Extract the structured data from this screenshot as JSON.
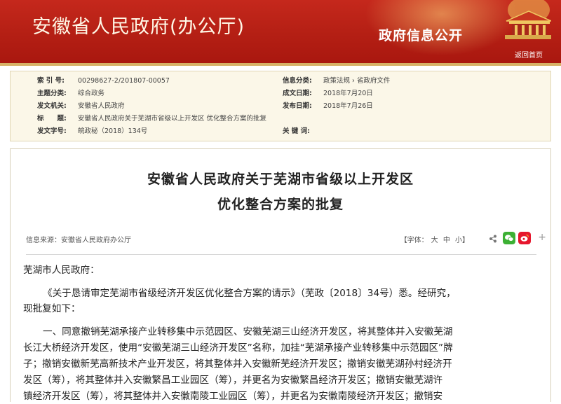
{
  "banner": {
    "site_title": "安徽省人民政府(办公厅)",
    "section_title": "政府信息公开",
    "back_home": "返回首页"
  },
  "meta": {
    "left": [
      {
        "label": "索 引 号:",
        "value": "00298627-2/201807-00057"
      },
      {
        "label": "主题分类:",
        "value": "综合政务"
      },
      {
        "label": "发文机关:",
        "value": "安徽省人民政府"
      },
      {
        "label": "标　　题:",
        "value": "安徽省人民政府关于芜湖市省级以上开发区 优化整合方案的批复"
      },
      {
        "label": "发文字号:",
        "value": "皖政秘（2018）134号"
      }
    ],
    "right": [
      {
        "label": "信息分类:",
        "value": "政策法规 › 省政府文件"
      },
      {
        "label": "成文日期:",
        "value": "2018年7月20日"
      },
      {
        "label": "发布日期:",
        "value": "2018年7月26日"
      },
      {
        "label": "关 键 词:",
        "value": ""
      }
    ]
  },
  "article": {
    "title_line1": "安徽省人民政府关于芜湖市省级以上开发区",
    "title_line2": "优化整合方案的批复",
    "source": "信息来源：安徽省人民政府办公厅",
    "font_label": "【字体：",
    "font_large": "大",
    "font_medium": "中",
    "font_small": "小】",
    "more": "+",
    "salutation": "芜湖市人民政府：",
    "para1_line1": "《关于恳请审定芜湖市省级经济开发区优化整合方案的请示》（芜政〔2018〕34号）悉。经研究，",
    "para1_line2": "现批复如下：",
    "para2_line1": "一、同意撤销芜湖承接产业转移集中示范园区、安徽芜湖三山经济开发区，将其整体并入安徽芜湖",
    "para2_line2": "长江大桥经济开发区，使用“安徽芜湖三山经济开发区”名称，加挂“芜湖承接产业转移集中示范园区”牌",
    "para2_line3": "子；撤销安徽新芜高新技术产业开发区，将其整体并入安徽新芜经济开发区；撤销安徽芜湖孙村经济开",
    "para2_line4": "发区（筹），将其整体并入安徽繁昌工业园区（筹），并更名为安徽繁昌经济开发区；撤销安徽芜湖许",
    "para2_line5": "镇经济开发区（筹），将其整体并入安徽南陵工业园区（筹），并更名为安徽南陵经济开发区；撤销安"
  },
  "colors": {
    "banner_red": "#b41f14",
    "gold": "#d7b267",
    "meta_bg": "#fbf7e8",
    "wechat": "#3cb034",
    "weibo": "#e6162d"
  }
}
